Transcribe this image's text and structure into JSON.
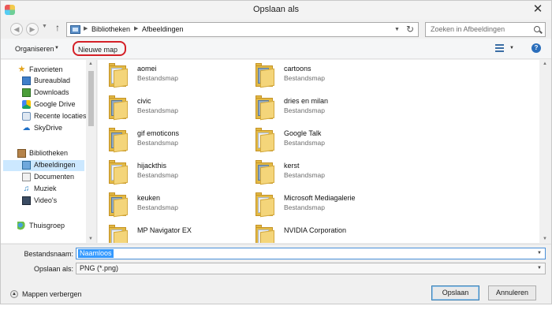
{
  "window": {
    "title": "Opslaan als",
    "close_glyph": "✕"
  },
  "address": {
    "crumbs": [
      "Bibliotheken",
      "Afbeeldingen"
    ],
    "search_placeholder": "Zoeken in Afbeeldingen"
  },
  "toolbar": {
    "organize_label": "Organiseren",
    "new_folder_label": "Nieuwe map",
    "help_label": "?",
    "highlight_color": "#d42027"
  },
  "nav": {
    "items": [
      {
        "label": "Favorieten",
        "icon": "star-icon"
      },
      {
        "label": "Bureaublad",
        "icon": "desktop-icon"
      },
      {
        "label": "Downloads",
        "icon": "downloads-icon"
      },
      {
        "label": "Google Drive",
        "icon": "google-drive-icon"
      },
      {
        "label": "Recente locaties",
        "icon": "recent-places-icon"
      },
      {
        "label": "SkyDrive",
        "icon": "skydrive-icon"
      },
      {
        "label": "Bibliotheken",
        "icon": "libraries-icon"
      },
      {
        "label": "Afbeeldingen",
        "icon": "pictures-icon",
        "selected": true
      },
      {
        "label": "Documenten",
        "icon": "documents-icon"
      },
      {
        "label": "Muziek",
        "icon": "music-icon"
      },
      {
        "label": "Video's",
        "icon": "videos-icon"
      },
      {
        "label": "Thuisgroep",
        "icon": "homegroup-icon"
      }
    ]
  },
  "files": {
    "items": [
      {
        "name": "aomei",
        "type": "Bestandsmap"
      },
      {
        "name": "cartoons",
        "type": "Bestandsmap"
      },
      {
        "name": "civic",
        "type": "Bestandsmap"
      },
      {
        "name": "dries en milan",
        "type": "Bestandsmap"
      },
      {
        "name": "gif emoticons",
        "type": "Bestandsmap"
      },
      {
        "name": "Google Talk",
        "type": "Bestandsmap"
      },
      {
        "name": "hijackthis",
        "type": "Bestandsmap"
      },
      {
        "name": "kerst",
        "type": "Bestandsmap"
      },
      {
        "name": "keuken",
        "type": "Bestandsmap"
      },
      {
        "name": "Microsoft Mediagalerie",
        "type": "Bestandsmap"
      },
      {
        "name": "MP Navigator EX",
        "type": ""
      },
      {
        "name": "NVIDIA Corporation",
        "type": ""
      }
    ]
  },
  "form": {
    "filename_label": "Bestandsnaam:",
    "filename_value": "Naamloos",
    "savetype_label": "Opslaan als:",
    "savetype_value": "PNG (*.png)"
  },
  "footer": {
    "hide_folders_label": "Mappen verbergen",
    "save_label": "Opslaan",
    "cancel_label": "Annuleren"
  }
}
